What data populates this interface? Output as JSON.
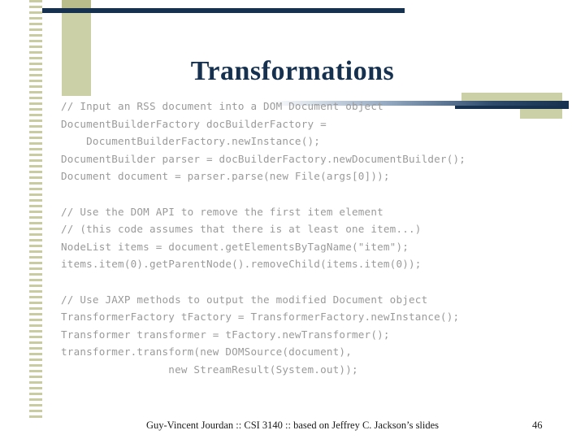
{
  "slide": {
    "title": "Transformations",
    "footer": "Guy-Vincent Jourdan :: CSI 3140 :: based on Jeffrey C. Jackson’s slides",
    "page_number": "46",
    "colors": {
      "title": "#16314f",
      "code": "#9a9a9a",
      "accent_olive": "#ccd0a6",
      "accent_navy": "#16314f"
    }
  },
  "code": {
    "lines": [
      "// Input an RSS document into a DOM Document object",
      "DocumentBuilderFactory docBuilderFactory =",
      "    DocumentBuilderFactory.newInstance();",
      "DocumentBuilder parser = docBuilderFactory.newDocumentBuilder();",
      "Document document = parser.parse(new File(args[0]));",
      "",
      "// Use the DOM API to remove the first item element",
      "// (this code assumes that there is at least one item...)",
      "NodeList items = document.getElementsByTagName(\"item\");",
      "items.item(0).getParentNode().removeChild(items.item(0));",
      "",
      "// Use JAXP methods to output the modified Document object",
      "TransformerFactory tFactory = TransformerFactory.newInstance();",
      "Transformer transformer = tFactory.newTransformer();",
      "transformer.transform(new DOMSource(document),",
      "                 new StreamResult(System.out));"
    ]
  }
}
